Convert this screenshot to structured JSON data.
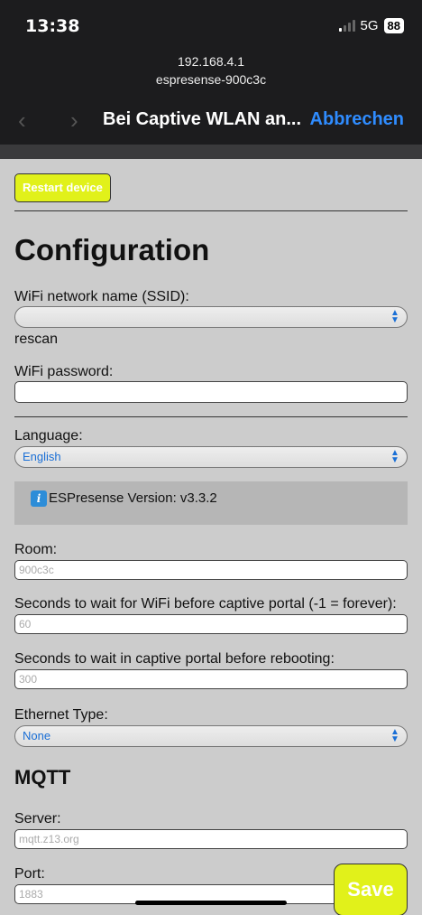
{
  "status": {
    "time": "13:38",
    "network": "5G",
    "battery": "88"
  },
  "browser": {
    "url": "192.168.4.1",
    "host": "espresense-900c3c",
    "title": "Bei Captive WLAN an...",
    "cancel_label": "Abbrechen",
    "back_icon": "chevron-left-icon",
    "forward_icon": "chevron-right-icon"
  },
  "page": {
    "restart_label": "Restart device",
    "heading": "Configuration",
    "ssid": {
      "label": "WiFi network name (SSID):",
      "value": ""
    },
    "rescan_label": "rescan",
    "password": {
      "label": "WiFi password:",
      "value": ""
    },
    "language": {
      "label": "Language:",
      "value": "English"
    },
    "version_text": "ESPresense Version: v3.3.2",
    "room": {
      "label": "Room:",
      "placeholder": "900c3c"
    },
    "wifi_wait": {
      "label": "Seconds to wait for WiFi before captive portal (-1 = forever):",
      "placeholder": "60"
    },
    "portal_wait": {
      "label": "Seconds to wait in captive portal before rebooting:",
      "placeholder": "300"
    },
    "ethernet": {
      "label": "Ethernet Type:",
      "value": "None"
    },
    "mqtt_heading": "MQTT",
    "server": {
      "label": "Server:",
      "placeholder": "mqtt.z13.org"
    },
    "port": {
      "label": "Port:",
      "placeholder": "1883"
    },
    "save_label": "Save"
  },
  "colors": {
    "accent": "#e1f11a",
    "link": "#2f8cff",
    "background": "#cccccc"
  }
}
